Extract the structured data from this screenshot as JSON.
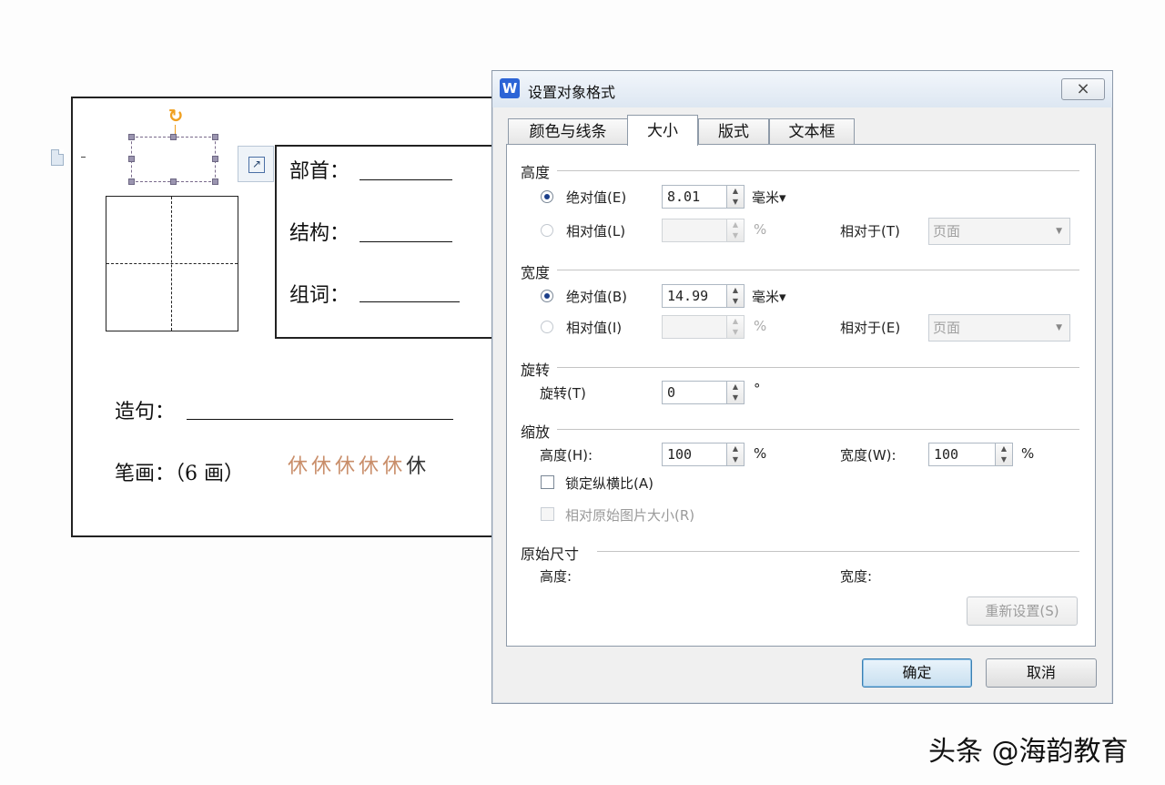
{
  "document": {
    "bushou_label": "部首：",
    "jiegou_label": "结构：",
    "zuci_label": "组词：",
    "zaoju_label": "造句：",
    "bihua_label": "笔画：（6 画）",
    "stroke_chars": [
      "休",
      "休",
      "休",
      "休",
      "休",
      "休"
    ]
  },
  "dialog": {
    "app_icon": "W",
    "title": "设置对象格式",
    "close_glyph": "⨯",
    "tabs": [
      {
        "label": "颜色与线条",
        "active": false
      },
      {
        "label": "大小",
        "active": true
      },
      {
        "label": "版式",
        "active": false
      },
      {
        "label": "文本框",
        "active": false
      }
    ],
    "height_section": {
      "title": "高度",
      "absolute_label": "绝对值(E)",
      "absolute_value": "8.01",
      "unit": "毫米▾",
      "relative_label": "相对值(L)",
      "relative_value": "",
      "relative_unit": "%",
      "relative_to_label": "相对于(T)",
      "relative_to_value": "页面"
    },
    "width_section": {
      "title": "宽度",
      "absolute_label": "绝对值(B)",
      "absolute_value": "14.99",
      "unit": "毫米▾",
      "relative_label": "相对值(I)",
      "relative_value": "",
      "relative_unit": "%",
      "relative_to_label": "相对于(E)",
      "relative_to_value": "页面"
    },
    "rotation_section": {
      "title": "旋转",
      "label": "旋转(T)",
      "value": "0",
      "unit": "°"
    },
    "scale_section": {
      "title": "缩放",
      "height_label": "高度(H):",
      "height_value": "100",
      "width_label": "宽度(W):",
      "width_value": "100",
      "unit": "%",
      "lock_ratio_label": "锁定纵横比(A)",
      "relative_original_label": "相对原始图片大小(R)"
    },
    "original_section": {
      "title": "原始尺寸",
      "height_label": "高度:",
      "width_label": "宽度:",
      "reset_label": "重新设置(S)"
    },
    "ok_label": "确定",
    "cancel_label": "取消"
  },
  "watermark": "头条 @海韵教育"
}
